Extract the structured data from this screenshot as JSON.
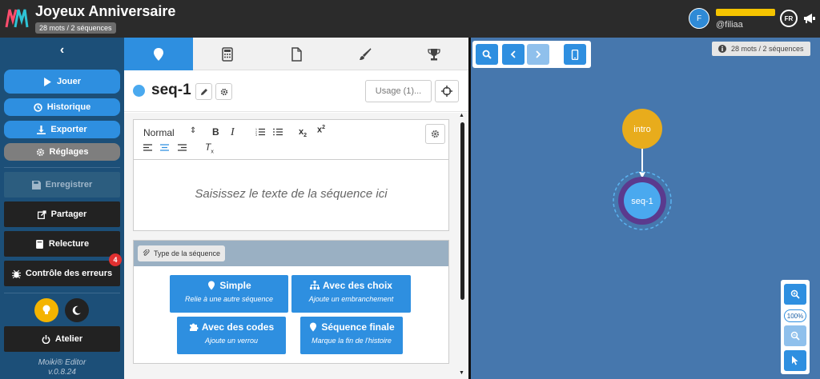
{
  "header": {
    "title": "Joyeux Anniversaire",
    "word_count": "28 mots / 2 séquences",
    "user_initial": "F",
    "user_handle": "@filiaa",
    "language": "FR"
  },
  "sidebar": {
    "play": "Jouer",
    "history": "Historique",
    "export": "Exporter",
    "settings": "Réglages",
    "save": "Enregistrer",
    "share": "Partager",
    "review": "Relecture",
    "error_check": "Contrôle des erreurs",
    "error_count": "4",
    "workshop": "Atelier",
    "editor_name": "Moiki® Editor",
    "version": "v.0.8.24"
  },
  "sequence": {
    "name": "seq-1",
    "color": "#4aa9ef",
    "usage_label": "Usage (1)...",
    "editor": {
      "format_select": "Normal",
      "placeholder": "Saisissez le texte de la séquence ici"
    },
    "type_label": "Type de la séquence",
    "types": [
      {
        "title": "Simple",
        "subtitle": "Relie à une autre séquence",
        "icon": "map-marker-icon"
      },
      {
        "title": "Avec des choix",
        "subtitle": "Ajoute un embranchement",
        "icon": "sitemap-icon"
      },
      {
        "title": "Avec des codes",
        "subtitle": "Ajoute un verrou",
        "icon": "puzzle-icon"
      },
      {
        "title": "Séquence finale",
        "subtitle": "Marque la fin de l'histoire",
        "icon": "map-marker-icon"
      }
    ]
  },
  "canvas": {
    "counter": "28 mots / 2 séquences",
    "zoom_level": "100%",
    "nodes": [
      {
        "label": "intro",
        "color": "#e8ac1c"
      },
      {
        "label": "seq-1",
        "color": "#4aa9ef",
        "ring_color": "#5b3a8e"
      }
    ]
  },
  "colors": {
    "accent": "#2e8fe0",
    "sidebar": "#1c4f78",
    "canvas": "#4677ad",
    "topbar": "#2b2b2b"
  }
}
